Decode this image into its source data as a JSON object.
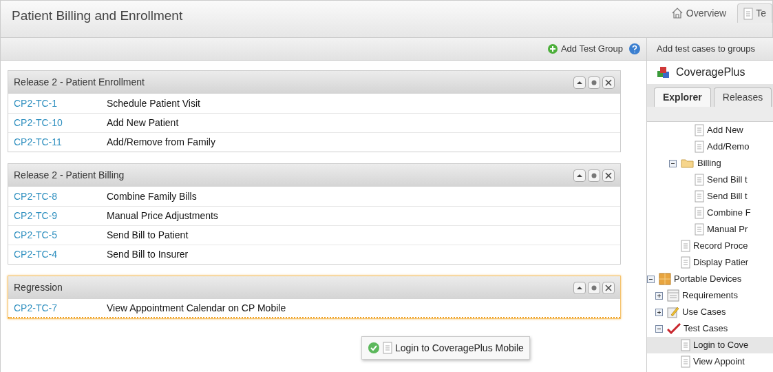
{
  "header": {
    "title": "Patient Billing and Enrollment",
    "tabs": [
      {
        "label": "Overview",
        "kind": "home",
        "selected": false
      },
      {
        "label": "Te",
        "kind": "doc",
        "selected": true
      }
    ]
  },
  "toolbar": {
    "add_button": "Add Test Group"
  },
  "groups": [
    {
      "title": "Release 2 - Patient Enrollment",
      "highlighted": false,
      "rows": [
        {
          "id": "CP2-TC-1",
          "name": "Schedule Patient Visit"
        },
        {
          "id": "CP2-TC-10",
          "name": "Add New Patient"
        },
        {
          "id": "CP2-TC-11",
          "name": "Add/Remove from Family"
        }
      ]
    },
    {
      "title": "Release 2 - Patient Billing",
      "highlighted": false,
      "rows": [
        {
          "id": "CP2-TC-8",
          "name": "Combine Family Bills"
        },
        {
          "id": "CP2-TC-9",
          "name": "Manual Price Adjustments"
        },
        {
          "id": "CP2-TC-5",
          "name": "Send Bill to Patient"
        },
        {
          "id": "CP2-TC-4",
          "name": "Send Bill to Insurer"
        }
      ]
    },
    {
      "title": "Regression",
      "highlighted": true,
      "rows": [
        {
          "id": "CP2-TC-7",
          "name": "View Appointment Calendar on CP Mobile"
        }
      ]
    }
  ],
  "drag_item": {
    "label": "Login to CoveragePlus Mobile"
  },
  "side_panel": {
    "title": "Add test cases to groups",
    "project": "CoveragePlus",
    "tabs": [
      {
        "label": "Explorer",
        "selected": true
      },
      {
        "label": "Releases",
        "selected": false
      }
    ],
    "tree": [
      {
        "children": [
          {
            "children": [
              {
                "children": [
                  {
                    "label": "Add New",
                    "kind": "page"
                  },
                  {
                    "label": "Add/Remo",
                    "kind": "page"
                  }
                ]
              },
              {
                "label": "Billing",
                "kind": "folder",
                "expanded": true,
                "children": [
                  {
                    "label": "Send Bill t",
                    "kind": "page"
                  },
                  {
                    "label": "Send Bill t",
                    "kind": "page"
                  },
                  {
                    "label": "Combine F",
                    "kind": "page"
                  },
                  {
                    "label": "Manual Pr",
                    "kind": "page"
                  }
                ]
              },
              {
                "label": "Record Proce",
                "kind": "page"
              },
              {
                "label": "Display Patier",
                "kind": "page"
              }
            ]
          }
        ]
      },
      {
        "label": "Portable Devices",
        "kind": "grid",
        "expanded": true,
        "children": [
          {
            "label": "Requirements",
            "kind": "table",
            "expanded": false
          },
          {
            "label": "Use Cases",
            "kind": "pencil",
            "expanded": false
          },
          {
            "label": "Test Cases",
            "kind": "check",
            "expanded": true,
            "children": [
              {
                "label": "Login to Cove",
                "kind": "page",
                "selected": true
              },
              {
                "label": "View Appoint",
                "kind": "page",
                "selected": false
              }
            ]
          }
        ]
      }
    ]
  }
}
